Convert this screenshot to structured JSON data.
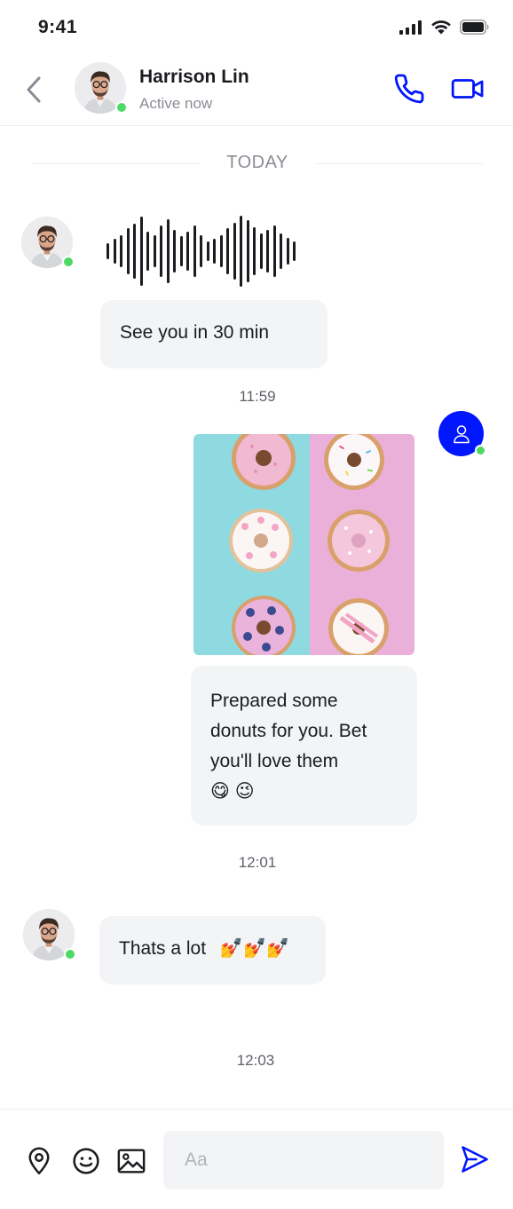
{
  "status_bar": {
    "time": "9:41"
  },
  "header": {
    "contact_name": "Harrison Lin",
    "contact_status": "Active now",
    "accent_color": "#0016ff",
    "online_color": "#4cd964"
  },
  "chat": {
    "date_divider": "TODAY",
    "messages": [
      {
        "sender": "Harrison Lin",
        "type": "voice"
      },
      {
        "sender": "Harrison Lin",
        "type": "text",
        "text": "See you in 30 min"
      },
      {
        "type": "timestamp",
        "text": "11:59"
      },
      {
        "sender": "me",
        "type": "image",
        "subject": "donuts"
      },
      {
        "sender": "me",
        "type": "text",
        "text": "Prepared some donuts for you. Bet you'll love them",
        "emoji": "😋 😉"
      },
      {
        "type": "timestamp",
        "text": "12:01"
      },
      {
        "sender": "Harrison Lin",
        "type": "text",
        "text": "Thats a lot",
        "emoji": "💅💅💅"
      },
      {
        "type": "timestamp",
        "text": "12:03"
      }
    ]
  },
  "composer": {
    "placeholder": "Aa",
    "icons": [
      "location-pin-icon",
      "emoji-icon",
      "image-icon",
      "send-icon"
    ]
  }
}
